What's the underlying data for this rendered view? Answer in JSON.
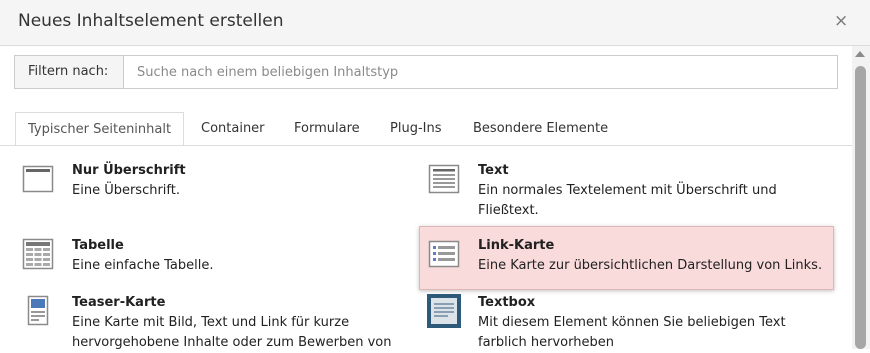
{
  "dialog": {
    "title": "Neues Inhaltselement erstellen",
    "close_symbol": "×"
  },
  "filter": {
    "label": "Filtern nach:",
    "placeholder": "Suche nach einem beliebigen Inhaltstyp",
    "value": ""
  },
  "tabs": [
    {
      "label": "Typischer Seiteninhalt",
      "active": true
    },
    {
      "label": "Container"
    },
    {
      "label": "Formulare"
    },
    {
      "label": "Plug-Ins"
    },
    {
      "label": "Besondere Elemente"
    }
  ],
  "items": [
    {
      "title": "Nur Überschrift",
      "desc1": "Eine Überschrift.",
      "icon": "header-only-icon"
    },
    {
      "title": "Text",
      "desc1": "Ein normales Textelement mit Überschrift und",
      "desc2": "Fließtext.",
      "icon": "text-icon"
    },
    {
      "title": "Tabelle",
      "desc1": "Eine einfache Tabelle.",
      "icon": "table-icon"
    },
    {
      "title": "Link-Karte",
      "desc1": "Eine Karte zur übersichtlichen Darstellung von Links.",
      "icon": "link-card-icon",
      "highlighted": true
    },
    {
      "title": "Teaser-Karte",
      "desc1": "Eine Karte mit Bild, Text und Link für kurze",
      "desc2": "hervorgehobene Inhalte oder zum Bewerben von",
      "icon": "teaser-card-icon"
    },
    {
      "title": "Textbox",
      "desc1": "Mit diesem Element können Sie beliebigen Text",
      "desc2": "farblich hervorheben",
      "icon": "textbox-icon"
    }
  ],
  "colors": {
    "highlight_bg": "#fadbdb",
    "textbox_icon": "#2e5a7a",
    "teaser_icon_accent": "#4a78b8"
  }
}
